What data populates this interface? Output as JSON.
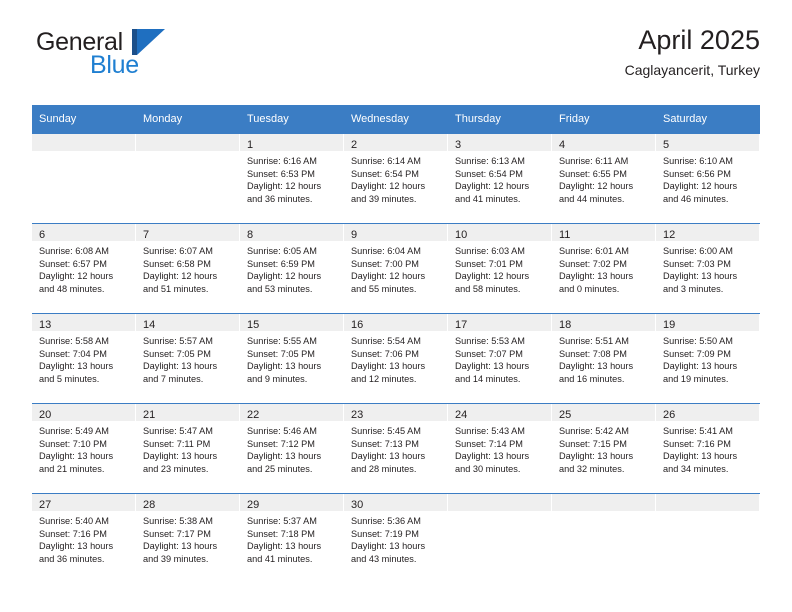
{
  "brand": {
    "name_part1": "General",
    "name_part2": "Blue",
    "logo_icon": "general-blue-triangle-logo"
  },
  "header": {
    "title": "April 2025",
    "subtitle": "Caglayancerit, Turkey"
  },
  "calendar": {
    "weekday_headers": [
      "Sunday",
      "Monday",
      "Tuesday",
      "Wednesday",
      "Thursday",
      "Friday",
      "Saturday"
    ],
    "colors": {
      "header_blue": "#3b7dc4",
      "band_gray": "#efefef",
      "text": "#231f20",
      "brand_blue": "#1f7fd1",
      "logo_dark_blue": "#1b4f8a"
    },
    "weeks": [
      [
        {
          "day": "",
          "sunrise": "",
          "sunset": "",
          "daylight_line1": "",
          "daylight_line2": ""
        },
        {
          "day": "",
          "sunrise": "",
          "sunset": "",
          "daylight_line1": "",
          "daylight_line2": ""
        },
        {
          "day": "1",
          "sunrise": "Sunrise: 6:16 AM",
          "sunset": "Sunset: 6:53 PM",
          "daylight_line1": "Daylight: 12 hours",
          "daylight_line2": "and 36 minutes."
        },
        {
          "day": "2",
          "sunrise": "Sunrise: 6:14 AM",
          "sunset": "Sunset: 6:54 PM",
          "daylight_line1": "Daylight: 12 hours",
          "daylight_line2": "and 39 minutes."
        },
        {
          "day": "3",
          "sunrise": "Sunrise: 6:13 AM",
          "sunset": "Sunset: 6:54 PM",
          "daylight_line1": "Daylight: 12 hours",
          "daylight_line2": "and 41 minutes."
        },
        {
          "day": "4",
          "sunrise": "Sunrise: 6:11 AM",
          "sunset": "Sunset: 6:55 PM",
          "daylight_line1": "Daylight: 12 hours",
          "daylight_line2": "and 44 minutes."
        },
        {
          "day": "5",
          "sunrise": "Sunrise: 6:10 AM",
          "sunset": "Sunset: 6:56 PM",
          "daylight_line1": "Daylight: 12 hours",
          "daylight_line2": "and 46 minutes."
        }
      ],
      [
        {
          "day": "6",
          "sunrise": "Sunrise: 6:08 AM",
          "sunset": "Sunset: 6:57 PM",
          "daylight_line1": "Daylight: 12 hours",
          "daylight_line2": "and 48 minutes."
        },
        {
          "day": "7",
          "sunrise": "Sunrise: 6:07 AM",
          "sunset": "Sunset: 6:58 PM",
          "daylight_line1": "Daylight: 12 hours",
          "daylight_line2": "and 51 minutes."
        },
        {
          "day": "8",
          "sunrise": "Sunrise: 6:05 AM",
          "sunset": "Sunset: 6:59 PM",
          "daylight_line1": "Daylight: 12 hours",
          "daylight_line2": "and 53 minutes."
        },
        {
          "day": "9",
          "sunrise": "Sunrise: 6:04 AM",
          "sunset": "Sunset: 7:00 PM",
          "daylight_line1": "Daylight: 12 hours",
          "daylight_line2": "and 55 minutes."
        },
        {
          "day": "10",
          "sunrise": "Sunrise: 6:03 AM",
          "sunset": "Sunset: 7:01 PM",
          "daylight_line1": "Daylight: 12 hours",
          "daylight_line2": "and 58 minutes."
        },
        {
          "day": "11",
          "sunrise": "Sunrise: 6:01 AM",
          "sunset": "Sunset: 7:02 PM",
          "daylight_line1": "Daylight: 13 hours",
          "daylight_line2": "and 0 minutes."
        },
        {
          "day": "12",
          "sunrise": "Sunrise: 6:00 AM",
          "sunset": "Sunset: 7:03 PM",
          "daylight_line1": "Daylight: 13 hours",
          "daylight_line2": "and 3 minutes."
        }
      ],
      [
        {
          "day": "13",
          "sunrise": "Sunrise: 5:58 AM",
          "sunset": "Sunset: 7:04 PM",
          "daylight_line1": "Daylight: 13 hours",
          "daylight_line2": "and 5 minutes."
        },
        {
          "day": "14",
          "sunrise": "Sunrise: 5:57 AM",
          "sunset": "Sunset: 7:05 PM",
          "daylight_line1": "Daylight: 13 hours",
          "daylight_line2": "and 7 minutes."
        },
        {
          "day": "15",
          "sunrise": "Sunrise: 5:55 AM",
          "sunset": "Sunset: 7:05 PM",
          "daylight_line1": "Daylight: 13 hours",
          "daylight_line2": "and 9 minutes."
        },
        {
          "day": "16",
          "sunrise": "Sunrise: 5:54 AM",
          "sunset": "Sunset: 7:06 PM",
          "daylight_line1": "Daylight: 13 hours",
          "daylight_line2": "and 12 minutes."
        },
        {
          "day": "17",
          "sunrise": "Sunrise: 5:53 AM",
          "sunset": "Sunset: 7:07 PM",
          "daylight_line1": "Daylight: 13 hours",
          "daylight_line2": "and 14 minutes."
        },
        {
          "day": "18",
          "sunrise": "Sunrise: 5:51 AM",
          "sunset": "Sunset: 7:08 PM",
          "daylight_line1": "Daylight: 13 hours",
          "daylight_line2": "and 16 minutes."
        },
        {
          "day": "19",
          "sunrise": "Sunrise: 5:50 AM",
          "sunset": "Sunset: 7:09 PM",
          "daylight_line1": "Daylight: 13 hours",
          "daylight_line2": "and 19 minutes."
        }
      ],
      [
        {
          "day": "20",
          "sunrise": "Sunrise: 5:49 AM",
          "sunset": "Sunset: 7:10 PM",
          "daylight_line1": "Daylight: 13 hours",
          "daylight_line2": "and 21 minutes."
        },
        {
          "day": "21",
          "sunrise": "Sunrise: 5:47 AM",
          "sunset": "Sunset: 7:11 PM",
          "daylight_line1": "Daylight: 13 hours",
          "daylight_line2": "and 23 minutes."
        },
        {
          "day": "22",
          "sunrise": "Sunrise: 5:46 AM",
          "sunset": "Sunset: 7:12 PM",
          "daylight_line1": "Daylight: 13 hours",
          "daylight_line2": "and 25 minutes."
        },
        {
          "day": "23",
          "sunrise": "Sunrise: 5:45 AM",
          "sunset": "Sunset: 7:13 PM",
          "daylight_line1": "Daylight: 13 hours",
          "daylight_line2": "and 28 minutes."
        },
        {
          "day": "24",
          "sunrise": "Sunrise: 5:43 AM",
          "sunset": "Sunset: 7:14 PM",
          "daylight_line1": "Daylight: 13 hours",
          "daylight_line2": "and 30 minutes."
        },
        {
          "day": "25",
          "sunrise": "Sunrise: 5:42 AM",
          "sunset": "Sunset: 7:15 PM",
          "daylight_line1": "Daylight: 13 hours",
          "daylight_line2": "and 32 minutes."
        },
        {
          "day": "26",
          "sunrise": "Sunrise: 5:41 AM",
          "sunset": "Sunset: 7:16 PM",
          "daylight_line1": "Daylight: 13 hours",
          "daylight_line2": "and 34 minutes."
        }
      ],
      [
        {
          "day": "27",
          "sunrise": "Sunrise: 5:40 AM",
          "sunset": "Sunset: 7:16 PM",
          "daylight_line1": "Daylight: 13 hours",
          "daylight_line2": "and 36 minutes."
        },
        {
          "day": "28",
          "sunrise": "Sunrise: 5:38 AM",
          "sunset": "Sunset: 7:17 PM",
          "daylight_line1": "Daylight: 13 hours",
          "daylight_line2": "and 39 minutes."
        },
        {
          "day": "29",
          "sunrise": "Sunrise: 5:37 AM",
          "sunset": "Sunset: 7:18 PM",
          "daylight_line1": "Daylight: 13 hours",
          "daylight_line2": "and 41 minutes."
        },
        {
          "day": "30",
          "sunrise": "Sunrise: 5:36 AM",
          "sunset": "Sunset: 7:19 PM",
          "daylight_line1": "Daylight: 13 hours",
          "daylight_line2": "and 43 minutes."
        },
        {
          "day": "",
          "sunrise": "",
          "sunset": "",
          "daylight_line1": "",
          "daylight_line2": ""
        },
        {
          "day": "",
          "sunrise": "",
          "sunset": "",
          "daylight_line1": "",
          "daylight_line2": ""
        },
        {
          "day": "",
          "sunrise": "",
          "sunset": "",
          "daylight_line1": "",
          "daylight_line2": ""
        }
      ]
    ]
  }
}
